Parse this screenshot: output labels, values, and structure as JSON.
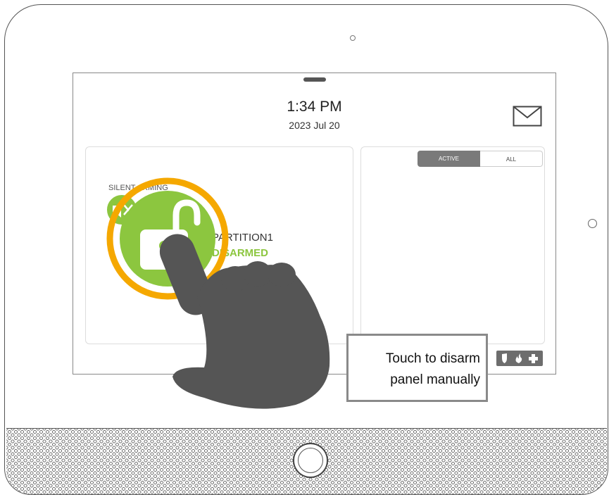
{
  "screen": {
    "time": "1:34 PM",
    "date": "2023 Jul 20",
    "mail_icon": "mail-icon"
  },
  "partition": {
    "silent_label": "SILENT ARMING",
    "name": "PARTITION1",
    "status": "DISARMED",
    "lock_icon": "unlocked-padlock-icon",
    "silent_icon": "speaker-muted-icon"
  },
  "events": {
    "tabs": [
      {
        "label": "ACTIVE",
        "selected": true
      },
      {
        "label": "ALL",
        "selected": false
      }
    ],
    "emergency_icons": [
      "shield-icon",
      "fire-icon",
      "medical-cross-icon"
    ]
  },
  "callout": {
    "line1": "Touch to disarm",
    "line2": "panel manually"
  },
  "colors": {
    "disarmed_green": "#8cc63f",
    "highlight_ring": "#f5a800",
    "hand": "#555555"
  }
}
